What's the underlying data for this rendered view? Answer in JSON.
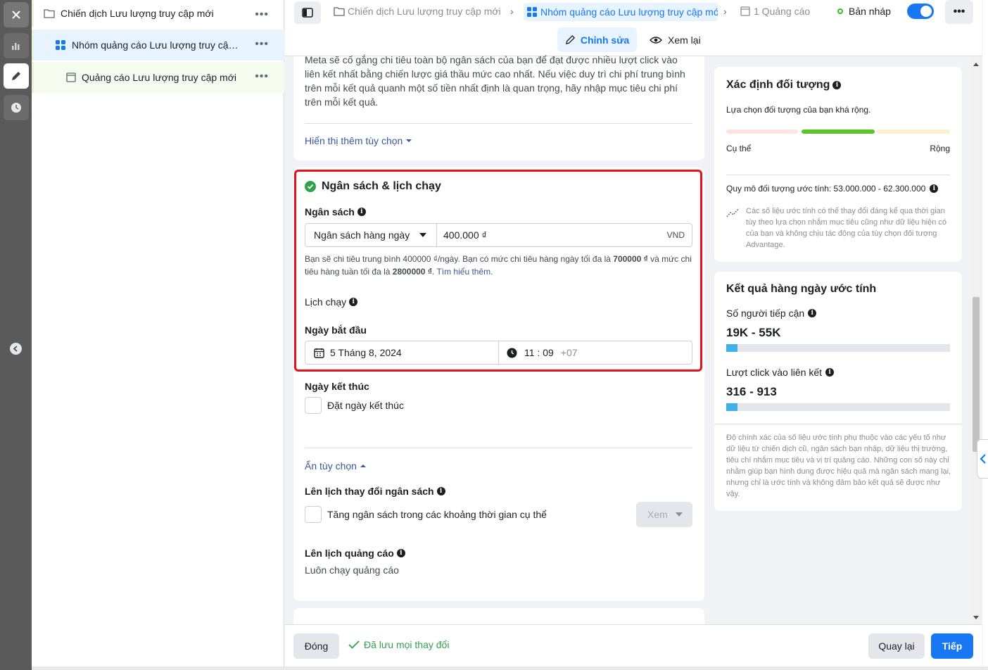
{
  "tree": {
    "campaign": "Chiến dịch Lưu lượng truy cập mới",
    "adset": "Nhóm quảng cáo Lưu lượng truy cập mới",
    "ad": "Quảng cáo Lưu lượng truy cập mới",
    "more": "•••"
  },
  "breadcrumb": {
    "campaign": "Chiến dịch Lưu lượng truy cập mới",
    "adset": "Nhóm quảng cáo Lưu lượng truy cập mới",
    "ad": "1 Quảng cáo",
    "separator": "›"
  },
  "header": {
    "status": "Bản nháp",
    "more": "•••",
    "tab_edit": "Chỉnh sửa",
    "tab_review": "Xem lại"
  },
  "top_card": {
    "text": "Meta sẽ cố gắng chi tiêu toàn bộ ngân sách của bạn để đạt được nhiều lượt click vào liên kết nhất bằng chiến lược giá thầu mức cao nhất. Nếu việc duy trì chi phí trung bình trên mỗi kết quả quanh một số tiền nhất định là quan trọng, hãy nhập mục tiêu chi phí trên mỗi kết quả.",
    "more_options": "Hiển thị thêm tùy chọn"
  },
  "budget": {
    "section_title": "Ngân sách & lịch chạy",
    "budget_label": "Ngân sách",
    "budget_type": "Ngân sách hàng ngày",
    "amount": "400.000 ₫",
    "currency": "VND",
    "note_1": "Bạn sẽ chi tiêu trung bình 400000 ₫/ngày. Bạn có mức chi tiêu hàng ngày tối đa là ",
    "note_daily_max": "700000 ₫",
    "note_2": " và mức chi tiêu hàng tuần tối đa là ",
    "note_weekly_max": "2800000 ₫",
    "note_3": ". ",
    "learn_more": "Tìm hiểu thêm.",
    "schedule_label": "Lịch chạy",
    "start_label": "Ngày bắt đầu",
    "start_date": "5 Tháng 8, 2024",
    "start_time": "11 : 09",
    "timezone": "+07",
    "end_label": "Ngày kết thúc",
    "end_checkbox": "Đặt ngày kết thúc",
    "hide_options": "Ẩn tùy chọn",
    "budget_schedule_label": "Lên lịch thay đổi ngân sách",
    "budget_schedule_checkbox": "Tăng ngân sách trong các khoảng thời gian cụ thể",
    "view_button": "Xem",
    "ad_schedule_label": "Lên lịch quảng cáo",
    "ad_schedule_value": "Luôn chạy quảng cáo"
  },
  "audience": {
    "title": "Xác định đối tượng",
    "subtitle": "Lựa chọn đối tượng của bạn khá rộng.",
    "specific": "Cụ thể",
    "broad": "Rộng",
    "size": "Quy mô đối tượng ước tính: 53.000.000 - 62.300.000",
    "disclaimer": "Các số liệu ước tính có thể thay đổi đáng kể qua thời gian tùy theo lựa chọn nhắm mục tiêu cũng như dữ liệu hiện có của bạn và không chịu tác động của tùy chọn đối tượng Advantage.",
    "colors": {
      "low": "#fde3e1",
      "mid": "#5ac726",
      "high": "#fdf1cf"
    }
  },
  "results": {
    "title": "Kết quả hàng ngày ước tính",
    "reach_label": "Số người tiếp cận",
    "reach_value": "19K - 55K",
    "reach_fill_pct": 5,
    "clicks_label": "Lượt click vào liên kết",
    "clicks_value": "316 - 913",
    "clicks_fill_pct": 5,
    "disclaimer": "Độ chính xác của số liệu ước tính phụ thuộc vào các yếu tố như dữ liệu từ chiến dịch cũ, ngân sách bạn nhập, dữ liệu thị trường, tiêu chí nhắm mục tiêu và vị trí quảng cáo. Những con số này chỉ nhằm giúp bạn hình dung được hiệu quả mà ngân sách mang lại, nhưng chỉ là ước tính và không đảm bảo kết quả sẽ được như vậy."
  },
  "footer": {
    "close": "Đóng",
    "saved": "Đã lưu mọi thay đổi",
    "back": "Quay lại",
    "next": "Tiếp"
  }
}
